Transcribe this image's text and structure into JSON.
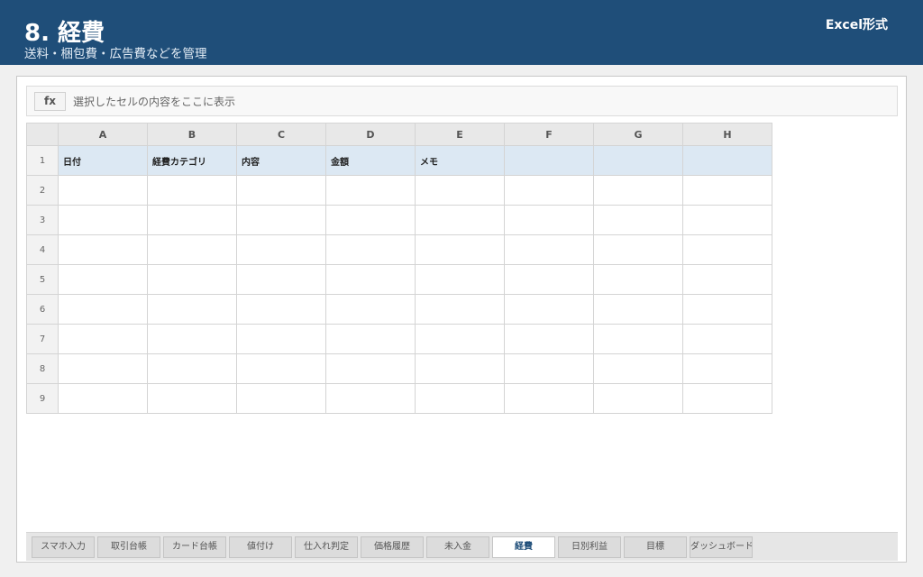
{
  "header": {
    "title": "8. 経費",
    "subtitle": "送料・梱包費・広告費などを管理",
    "format_label": "Excel形式"
  },
  "formula_bar": {
    "fx_label": "fx",
    "placeholder": "選択したセルの内容をここに表示"
  },
  "grid": {
    "columns": [
      "A",
      "B",
      "C",
      "D",
      "E",
      "F",
      "G",
      "H"
    ],
    "rows": [
      "1",
      "2",
      "3",
      "4",
      "5",
      "6",
      "7",
      "8",
      "9"
    ],
    "header_cells": [
      "日付",
      "経費カテゴリ",
      "内容",
      "金額",
      "メモ",
      "",
      "",
      ""
    ]
  },
  "tabs": [
    {
      "label": "スマホ入力"
    },
    {
      "label": "取引台帳"
    },
    {
      "label": "カード台帳"
    },
    {
      "label": "値付け"
    },
    {
      "label": "仕入れ判定"
    },
    {
      "label": "価格履歴"
    },
    {
      "label": "未入金"
    },
    {
      "label": "経費"
    },
    {
      "label": "日別利益"
    },
    {
      "label": "目標"
    },
    {
      "label": "ダッシュボード"
    }
  ],
  "active_tab": "経費",
  "colors": {
    "header_bg": "#1f4e79",
    "header_row_bg": "#dce8f3",
    "active_tab_text": "#1f4e79"
  }
}
